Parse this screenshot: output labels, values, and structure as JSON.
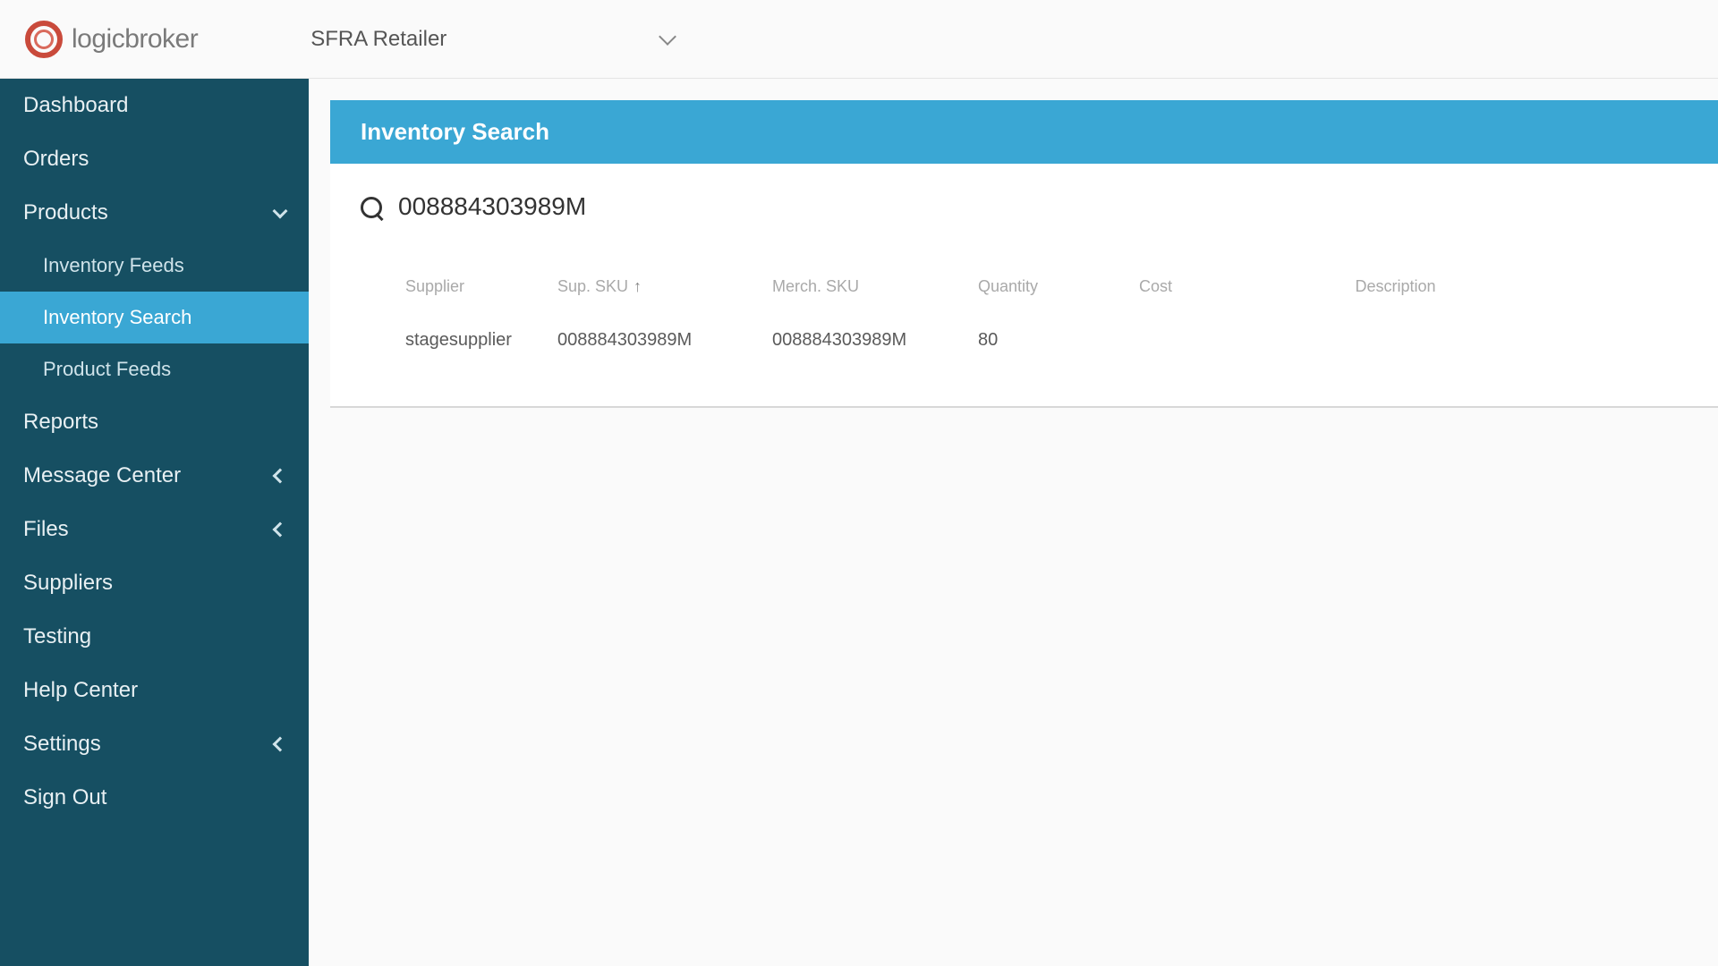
{
  "header": {
    "brand": "logicbroker",
    "company": "SFRA Retailer"
  },
  "sidebar": {
    "dashboard": "Dashboard",
    "orders": "Orders",
    "products": "Products",
    "inventory_feeds": "Inventory Feeds",
    "inventory_search": "Inventory Search",
    "product_feeds": "Product Feeds",
    "reports": "Reports",
    "message_center": "Message Center",
    "files": "Files",
    "suppliers": "Suppliers",
    "testing": "Testing",
    "help_center": "Help Center",
    "settings": "Settings",
    "sign_out": "Sign Out"
  },
  "panel": {
    "title": "Inventory Search",
    "search_value": "008884303989M"
  },
  "table": {
    "headers": {
      "supplier": "Supplier",
      "sup_sku": "Sup. SKU",
      "merch_sku": "Merch. SKU",
      "quantity": "Quantity",
      "cost": "Cost",
      "description": "Description"
    },
    "rows": [
      {
        "supplier": "stagesupplier",
        "sup_sku": "008884303989M",
        "merch_sku": "008884303989M",
        "quantity": "80",
        "cost": "",
        "description": ""
      }
    ]
  }
}
